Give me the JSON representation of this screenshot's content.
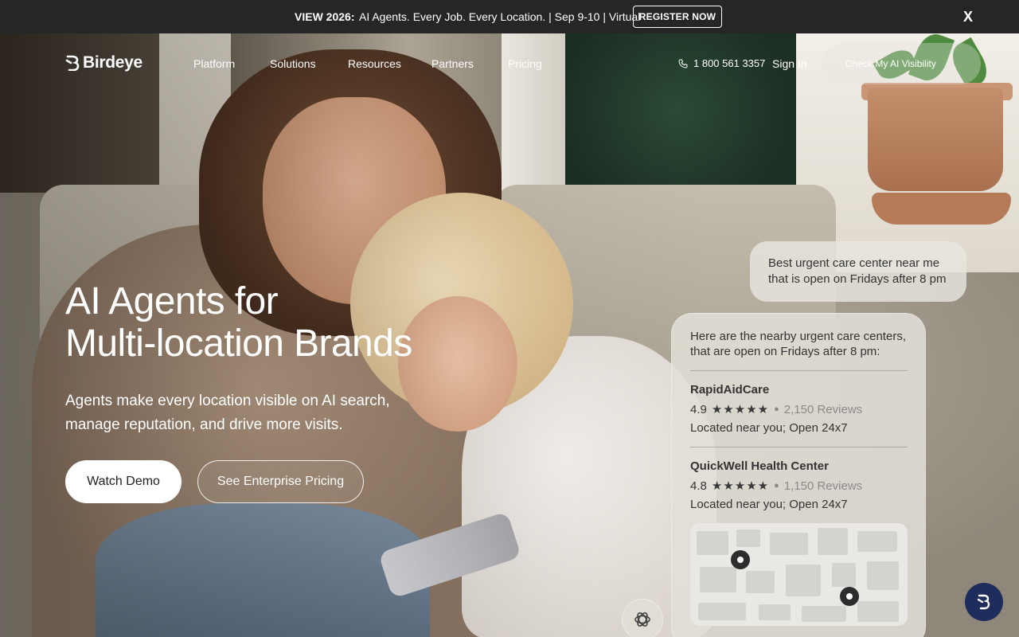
{
  "announcement": {
    "label": "VIEW 2026:",
    "text": "AI Agents. Every Job. Every Location. | Sep 9-10 | Virtual",
    "register_label": "REGISTER NOW",
    "close_label": "X"
  },
  "nav": {
    "brand": "Birdeye",
    "items": [
      {
        "label": "Platform"
      },
      {
        "label": "Solutions"
      },
      {
        "label": "Resources"
      },
      {
        "label": "Partners"
      },
      {
        "label": "Pricing"
      }
    ],
    "phone": "1 800 561 3357",
    "sign_in": "Sign In",
    "cta": "Check My AI Visibility"
  },
  "hero": {
    "title_line1": "AI Agents for",
    "title_line2": "Multi-location Brands",
    "subtitle": "Agents make every location visible on AI search, manage reputation, and drive more visits.",
    "primary_button": "Watch Demo",
    "secondary_button": "See Enterprise Pricing"
  },
  "ai_demo": {
    "query": "Best urgent care center near me that is open on Fridays after 8 pm",
    "intro": "Here are the nearby urgent care centers, that are open on Fridays after 8 pm:",
    "results": [
      {
        "name": "RapidAidCare",
        "rating": "4.9",
        "stars": 5,
        "reviews": "2,150 Reviews",
        "detail": "Located near you; Open 24x7"
      },
      {
        "name": "QuickWell Health Center",
        "rating": "4.8",
        "stars": 5,
        "reviews": "1,150 Reviews",
        "detail": "Located near you; Open 24x7"
      }
    ]
  },
  "icons": {
    "phone": "phone-icon",
    "logo": "birdeye-logo-icon",
    "ai": "openai-icon",
    "chat": "chat-widget-icon",
    "star": "star-icon",
    "pin": "map-pin-icon"
  },
  "colors": {
    "topbar_bg": "#262626",
    "chat_widget": "#1f2d5c",
    "card_bg": "#e2dfd7"
  }
}
